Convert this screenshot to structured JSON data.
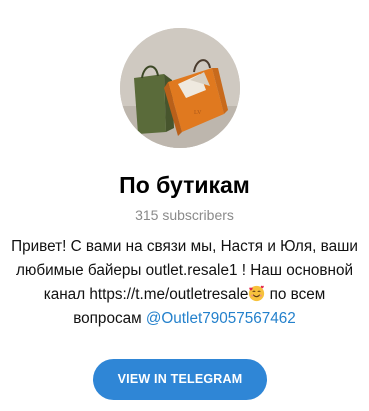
{
  "channel": {
    "title": "По бутикам",
    "subscribers": "315 subscribers",
    "avatar_icon": "shopping-bags-photo"
  },
  "description": {
    "line1": "Привет! С вами на связи мы, Настя и Юля, ваши",
    "line2": "любимые байеры outlet.resale1 ! Наш основной",
    "line3_before": "канал https://t.me/outletresale",
    "line3_emoji": "smiling-face-with-hearts-emoji",
    "line3_after": " по всем",
    "line4_before": "вопросам ",
    "line4_mention": "@Outlet79057567462"
  },
  "actions": {
    "view_in_telegram": "VIEW IN TELEGRAM"
  },
  "colors": {
    "accent": "#2f86d6",
    "link": "#2481cc",
    "muted": "#8a8a8a"
  }
}
